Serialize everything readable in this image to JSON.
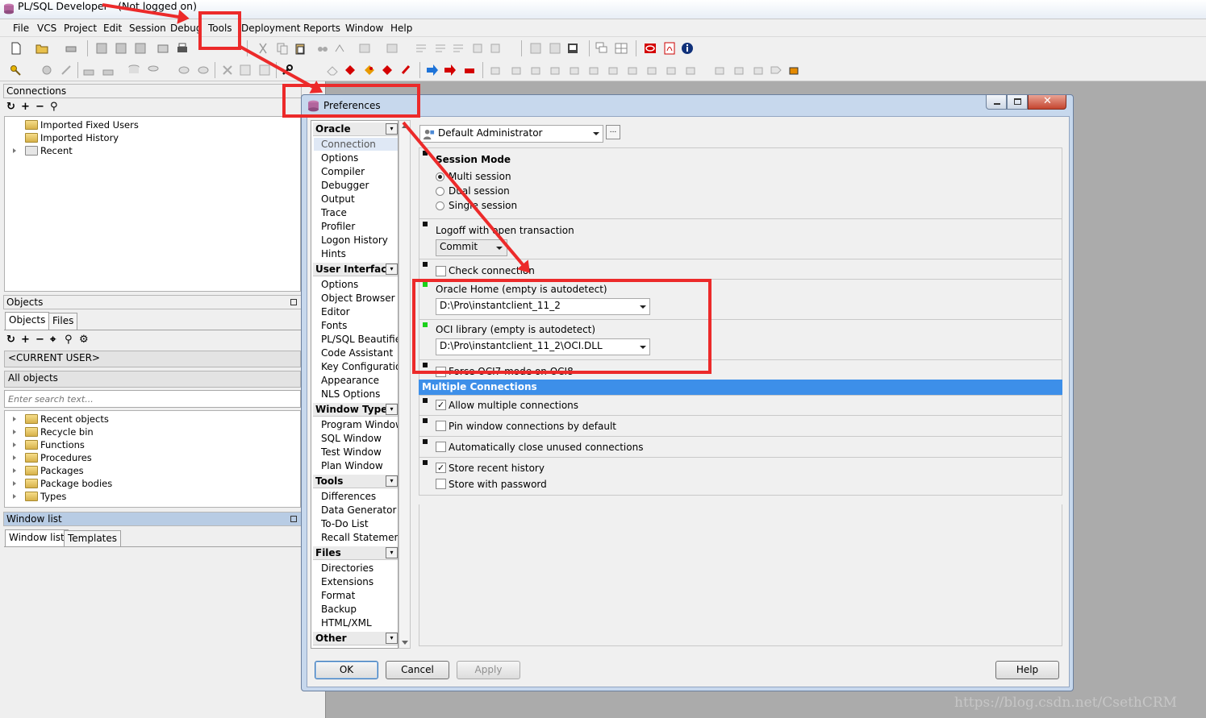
{
  "app": {
    "title": "PL/SQL Developer - (Not logged on)"
  },
  "menu": {
    "items": [
      "File",
      "VCS",
      "Project",
      "Edit",
      "Session",
      "Debug",
      "Tools",
      "Deployment",
      "Reports",
      "Window",
      "Help"
    ]
  },
  "left": {
    "connections": {
      "title": "Connections",
      "items": [
        "Imported Fixed Users",
        "Imported History",
        "Recent"
      ]
    },
    "objects": {
      "title": "Objects",
      "tabs": [
        "Objects",
        "Files"
      ],
      "user": "<CURRENT USER>",
      "filter": "All objects",
      "search_placeholder": "Enter search text...",
      "items": [
        "Recent objects",
        "Recycle bin",
        "Functions",
        "Procedures",
        "Packages",
        "Package bodies",
        "Types"
      ]
    },
    "windowlist": {
      "title": "Window list",
      "tabs": [
        "Window list",
        "Templates"
      ]
    }
  },
  "dialog": {
    "title": "Preferences",
    "categories": [
      {
        "name": "Oracle",
        "items": [
          "Connection",
          "Options",
          "Compiler",
          "Debugger",
          "Output",
          "Trace",
          "Profiler",
          "Logon History",
          "Hints"
        ]
      },
      {
        "name": "User Interface",
        "items": [
          "Options",
          "Object Browser",
          "Editor",
          "Fonts",
          "PL/SQL Beautifier",
          "Code Assistant",
          "Key Configuration",
          "Appearance",
          "NLS Options"
        ]
      },
      {
        "name": "Window Types",
        "items": [
          "Program Window",
          "SQL Window",
          "Test Window",
          "Plan Window"
        ]
      },
      {
        "name": "Tools",
        "items": [
          "Differences",
          "Data Generator",
          "To-Do List",
          "Recall Statement"
        ]
      },
      {
        "name": "Files",
        "items": [
          "Directories",
          "Extensions",
          "Format",
          "Backup",
          "HTML/XML"
        ]
      },
      {
        "name": "Other",
        "items": []
      }
    ],
    "selected": "Connection",
    "profile": "Default Administrator",
    "ellipsis": "...",
    "session_mode": {
      "title": "Session Mode",
      "options": [
        "Multi session",
        "Dual session",
        "Single session"
      ],
      "selected": "Multi session"
    },
    "logoff": {
      "label": "Logoff with open transaction",
      "value": "Commit"
    },
    "check_connection": {
      "label": "Check connection",
      "checked": false
    },
    "oracle_home": {
      "label": "Oracle Home (empty is autodetect)",
      "value": "D:\\Pro\\instantclient_11_2"
    },
    "oci_library": {
      "label": "OCI library (empty is autodetect)",
      "value": "D:\\Pro\\instantclient_11_2\\OCI.DLL"
    },
    "force_oci": {
      "label": "Force OCI7 mode on OCI8",
      "checked": false
    },
    "multiple_connections": {
      "title": "Multiple Connections",
      "allow": {
        "label": "Allow multiple connections",
        "checked": true
      },
      "pin": {
        "label": "Pin window connections by default",
        "checked": false
      },
      "autoclose": {
        "label": "Automatically close unused connections",
        "checked": false
      },
      "store_history": {
        "label": "Store recent history",
        "checked": true
      },
      "store_password": {
        "label": "Store with password",
        "checked": false
      }
    },
    "buttons": {
      "ok": "OK",
      "cancel": "Cancel",
      "apply": "Apply",
      "help": "Help"
    }
  },
  "watermark": "https://blog.csdn.net/CsethCRM",
  "colors": {
    "highlight": "#ec2a2a",
    "section": "#3d8fe9"
  }
}
